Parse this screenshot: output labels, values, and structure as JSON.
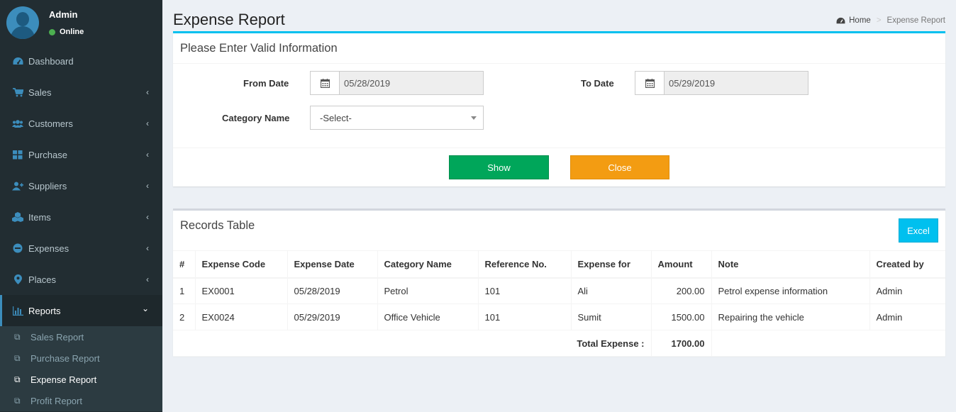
{
  "user": {
    "name": "Admin",
    "status": "Online"
  },
  "sidebar": {
    "items": [
      {
        "label": "Dashboard",
        "icon": "dashboard-icon"
      },
      {
        "label": "Sales",
        "icon": "cart-icon"
      },
      {
        "label": "Customers",
        "icon": "users-icon"
      },
      {
        "label": "Purchase",
        "icon": "grid-icon"
      },
      {
        "label": "Suppliers",
        "icon": "user-plus-icon"
      },
      {
        "label": "Items",
        "icon": "cubes-icon"
      },
      {
        "label": "Expenses",
        "icon": "minus-circle-icon"
      },
      {
        "label": "Places",
        "icon": "map-marker-icon"
      },
      {
        "label": "Reports",
        "icon": "bar-chart-icon"
      }
    ],
    "submenu": [
      {
        "label": "Sales Report"
      },
      {
        "label": "Purchase Report"
      },
      {
        "label": "Expense Report"
      },
      {
        "label": "Profit Report"
      }
    ]
  },
  "header": {
    "title": "Expense Report",
    "breadcrumb_home": "Home",
    "breadcrumb_current": "Expense Report"
  },
  "form": {
    "title": "Please Enter Valid Information",
    "from_label": "From Date",
    "from_value": "05/28/2019",
    "to_label": "To Date",
    "to_value": "05/29/2019",
    "category_label": "Category Name",
    "category_value": "-Select-",
    "show_label": "Show",
    "close_label": "Close"
  },
  "records": {
    "title": "Records Table",
    "excel_label": "Excel",
    "columns": [
      "#",
      "Expense Code",
      "Expense Date",
      "Category Name",
      "Reference No.",
      "Expense for",
      "Amount",
      "Note",
      "Created by"
    ],
    "rows": [
      [
        "1",
        "EX0001",
        "05/28/2019",
        "Petrol",
        "101",
        "Ali",
        "200.00",
        "Petrol expense information",
        "Admin"
      ],
      [
        "2",
        "EX0024",
        "05/29/2019",
        "Office Vehicle",
        "101",
        "Sumit",
        "1500.00",
        "Repairing the vehicle",
        "Admin"
      ]
    ],
    "total_label": "Total Expense :",
    "total_value": "1700.00"
  },
  "colors": {
    "sidebar_bg": "#222d32",
    "accent": "#00c0ef",
    "show": "#00a65a",
    "close": "#f39c12"
  }
}
